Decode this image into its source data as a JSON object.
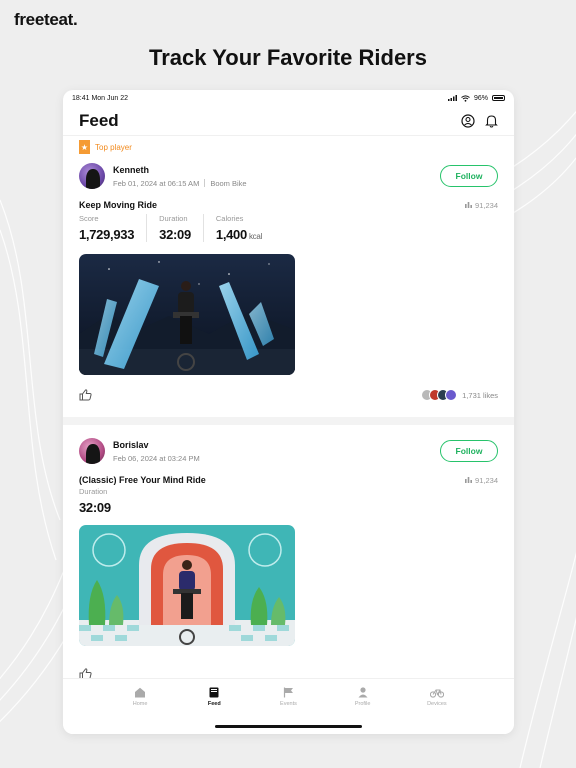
{
  "brand": {
    "logo": "freeteat."
  },
  "headline": "Track Your Favorite Riders",
  "status_bar": {
    "time": "18:41 Mon Jun 22",
    "battery": "96%"
  },
  "header": {
    "title": "Feed",
    "icons": [
      "user-circle-icon",
      "bell-icon"
    ]
  },
  "posts": [
    {
      "badge": "Top player",
      "user": "Kenneth",
      "date": "Feb 01, 2024 at 06:15 AM",
      "device": "Boom Bike",
      "follow": "Follow",
      "ride_title": "Keep Moving Ride",
      "views": "91,234",
      "stats": [
        {
          "label": "Score",
          "value": "1,729,933",
          "unit": ""
        },
        {
          "label": "Duration",
          "value": "32:09",
          "unit": ""
        },
        {
          "label": "Calories",
          "value": "1,400",
          "unit": "kcal"
        }
      ],
      "likes": "1,731 likes"
    },
    {
      "user": "Borislav",
      "date": "Feb 06, 2024 at 03:24 PM",
      "follow": "Follow",
      "ride_title": "(Classic) Free Your Mind Ride",
      "views": "91,234",
      "stats": [
        {
          "label": "Duration",
          "value": "32:09"
        }
      ]
    }
  ],
  "nav": [
    {
      "label": "Home",
      "icon": "home-icon",
      "active": false
    },
    {
      "label": "Feed",
      "icon": "feed-icon",
      "active": true
    },
    {
      "label": "Events",
      "icon": "flag-icon",
      "active": false
    },
    {
      "label": "Profile",
      "icon": "profile-icon",
      "active": false
    },
    {
      "label": "Devices",
      "icon": "bike-icon",
      "active": false
    }
  ],
  "colors": {
    "accent_green": "#1fb25f",
    "badge_orange": "#f28a1d"
  }
}
